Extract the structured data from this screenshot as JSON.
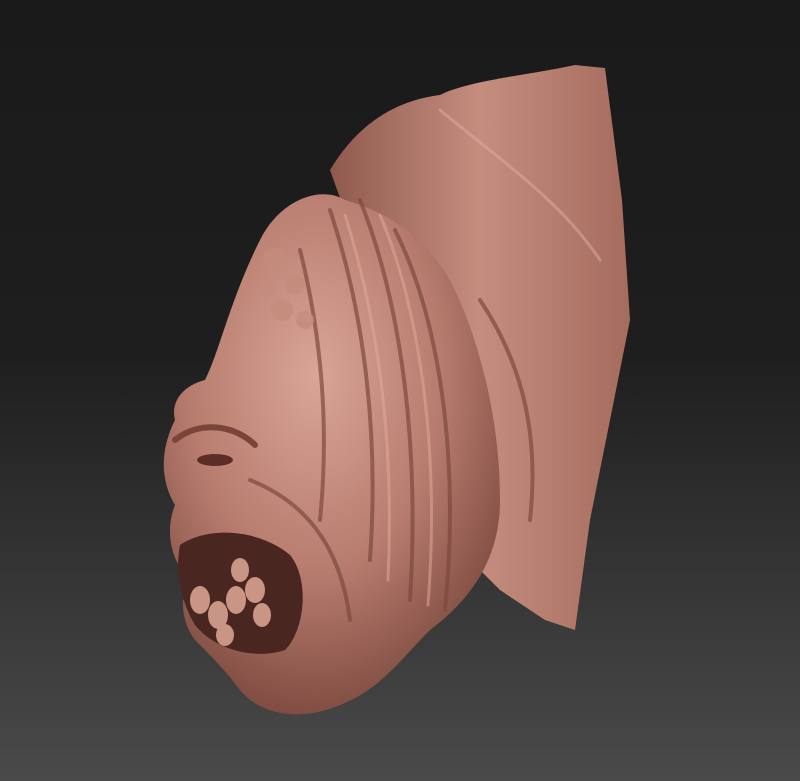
{
  "scene": {
    "subject": "sculpted-creature-head",
    "colors": {
      "background_top": "#1a1a1a",
      "background_bottom": "#4a4a4a",
      "clay_base": "#b77c6e",
      "clay_highlight": "#d9a596",
      "clay_shadow": "#6e3d33"
    }
  }
}
